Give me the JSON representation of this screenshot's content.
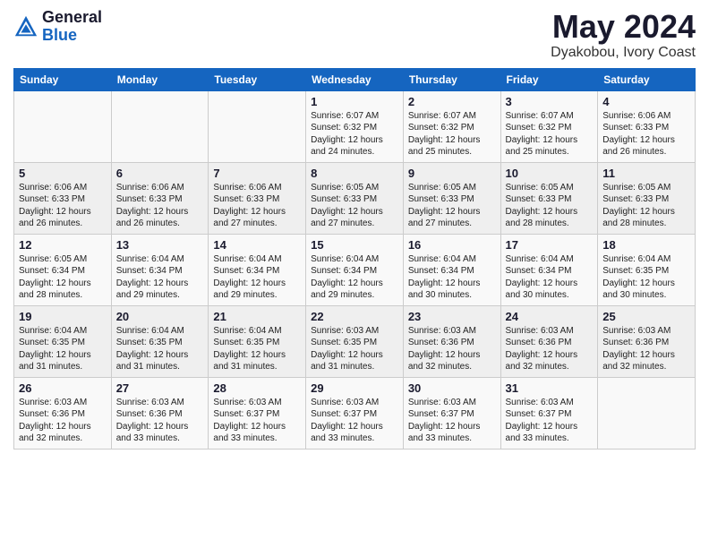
{
  "logo": {
    "general": "General",
    "blue": "Blue"
  },
  "title": {
    "month_year": "May 2024",
    "location": "Dyakobou, Ivory Coast"
  },
  "weekdays": [
    "Sunday",
    "Monday",
    "Tuesday",
    "Wednesday",
    "Thursday",
    "Friday",
    "Saturday"
  ],
  "weeks": [
    [
      {
        "day": "",
        "info": ""
      },
      {
        "day": "",
        "info": ""
      },
      {
        "day": "",
        "info": ""
      },
      {
        "day": "1",
        "info": "Sunrise: 6:07 AM\nSunset: 6:32 PM\nDaylight: 12 hours\nand 24 minutes."
      },
      {
        "day": "2",
        "info": "Sunrise: 6:07 AM\nSunset: 6:32 PM\nDaylight: 12 hours\nand 25 minutes."
      },
      {
        "day": "3",
        "info": "Sunrise: 6:07 AM\nSunset: 6:32 PM\nDaylight: 12 hours\nand 25 minutes."
      },
      {
        "day": "4",
        "info": "Sunrise: 6:06 AM\nSunset: 6:33 PM\nDaylight: 12 hours\nand 26 minutes."
      }
    ],
    [
      {
        "day": "5",
        "info": "Sunrise: 6:06 AM\nSunset: 6:33 PM\nDaylight: 12 hours\nand 26 minutes."
      },
      {
        "day": "6",
        "info": "Sunrise: 6:06 AM\nSunset: 6:33 PM\nDaylight: 12 hours\nand 26 minutes."
      },
      {
        "day": "7",
        "info": "Sunrise: 6:06 AM\nSunset: 6:33 PM\nDaylight: 12 hours\nand 27 minutes."
      },
      {
        "day": "8",
        "info": "Sunrise: 6:05 AM\nSunset: 6:33 PM\nDaylight: 12 hours\nand 27 minutes."
      },
      {
        "day": "9",
        "info": "Sunrise: 6:05 AM\nSunset: 6:33 PM\nDaylight: 12 hours\nand 27 minutes."
      },
      {
        "day": "10",
        "info": "Sunrise: 6:05 AM\nSunset: 6:33 PM\nDaylight: 12 hours\nand 28 minutes."
      },
      {
        "day": "11",
        "info": "Sunrise: 6:05 AM\nSunset: 6:33 PM\nDaylight: 12 hours\nand 28 minutes."
      }
    ],
    [
      {
        "day": "12",
        "info": "Sunrise: 6:05 AM\nSunset: 6:34 PM\nDaylight: 12 hours\nand 28 minutes."
      },
      {
        "day": "13",
        "info": "Sunrise: 6:04 AM\nSunset: 6:34 PM\nDaylight: 12 hours\nand 29 minutes."
      },
      {
        "day": "14",
        "info": "Sunrise: 6:04 AM\nSunset: 6:34 PM\nDaylight: 12 hours\nand 29 minutes."
      },
      {
        "day": "15",
        "info": "Sunrise: 6:04 AM\nSunset: 6:34 PM\nDaylight: 12 hours\nand 29 minutes."
      },
      {
        "day": "16",
        "info": "Sunrise: 6:04 AM\nSunset: 6:34 PM\nDaylight: 12 hours\nand 30 minutes."
      },
      {
        "day": "17",
        "info": "Sunrise: 6:04 AM\nSunset: 6:34 PM\nDaylight: 12 hours\nand 30 minutes."
      },
      {
        "day": "18",
        "info": "Sunrise: 6:04 AM\nSunset: 6:35 PM\nDaylight: 12 hours\nand 30 minutes."
      }
    ],
    [
      {
        "day": "19",
        "info": "Sunrise: 6:04 AM\nSunset: 6:35 PM\nDaylight: 12 hours\nand 31 minutes."
      },
      {
        "day": "20",
        "info": "Sunrise: 6:04 AM\nSunset: 6:35 PM\nDaylight: 12 hours\nand 31 minutes."
      },
      {
        "day": "21",
        "info": "Sunrise: 6:04 AM\nSunset: 6:35 PM\nDaylight: 12 hours\nand 31 minutes."
      },
      {
        "day": "22",
        "info": "Sunrise: 6:03 AM\nSunset: 6:35 PM\nDaylight: 12 hours\nand 31 minutes."
      },
      {
        "day": "23",
        "info": "Sunrise: 6:03 AM\nSunset: 6:36 PM\nDaylight: 12 hours\nand 32 minutes."
      },
      {
        "day": "24",
        "info": "Sunrise: 6:03 AM\nSunset: 6:36 PM\nDaylight: 12 hours\nand 32 minutes."
      },
      {
        "day": "25",
        "info": "Sunrise: 6:03 AM\nSunset: 6:36 PM\nDaylight: 12 hours\nand 32 minutes."
      }
    ],
    [
      {
        "day": "26",
        "info": "Sunrise: 6:03 AM\nSunset: 6:36 PM\nDaylight: 12 hours\nand 32 minutes."
      },
      {
        "day": "27",
        "info": "Sunrise: 6:03 AM\nSunset: 6:36 PM\nDaylight: 12 hours\nand 33 minutes."
      },
      {
        "day": "28",
        "info": "Sunrise: 6:03 AM\nSunset: 6:37 PM\nDaylight: 12 hours\nand 33 minutes."
      },
      {
        "day": "29",
        "info": "Sunrise: 6:03 AM\nSunset: 6:37 PM\nDaylight: 12 hours\nand 33 minutes."
      },
      {
        "day": "30",
        "info": "Sunrise: 6:03 AM\nSunset: 6:37 PM\nDaylight: 12 hours\nand 33 minutes."
      },
      {
        "day": "31",
        "info": "Sunrise: 6:03 AM\nSunset: 6:37 PM\nDaylight: 12 hours\nand 33 minutes."
      },
      {
        "day": "",
        "info": ""
      }
    ]
  ]
}
